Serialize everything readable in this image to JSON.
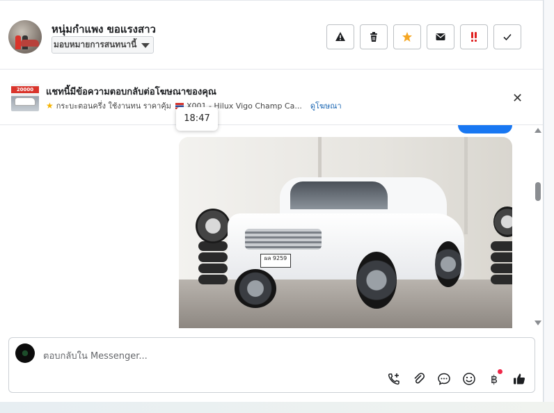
{
  "header": {
    "contact_name": "หนุ่มกำแพง ขอแรงสาว",
    "assign_label": "มอบหมายการสนทนานี้",
    "actions": [
      {
        "name": "report-spam-button",
        "icon": "warning-icon"
      },
      {
        "name": "delete-button",
        "icon": "trash-icon"
      },
      {
        "name": "star-button",
        "icon": "star-icon"
      },
      {
        "name": "mark-unread-button",
        "icon": "envelope-icon"
      },
      {
        "name": "follow-up-button",
        "icon": "exclamation-icon"
      },
      {
        "name": "mark-done-button",
        "icon": "check-icon"
      }
    ]
  },
  "ad": {
    "thumb_price": "20000",
    "title": "แชทนี้มีข้อความตอบกลับต่อโฆษณาของคุณ",
    "description": "กระบะตอนครึ่ง ใช้งานทน ราคาคุ้ม",
    "ad_name": "X001 - Hilux Vigo Champ Ca...",
    "view_ad_link": "ดูโฆษณา",
    "close_glyph": "✕"
  },
  "chat": {
    "tooltip_time": "18:47",
    "photo_plate": "ผล 9259",
    "photo_alt": "white pickup truck photo"
  },
  "composer": {
    "placeholder": "ตอบกลับใน Messenger...",
    "tools": [
      {
        "name": "call-icon",
        "label": "call"
      },
      {
        "name": "attach-icon",
        "label": "attach"
      },
      {
        "name": "saved-replies-icon",
        "label": "saved replies"
      },
      {
        "name": "emoji-icon",
        "label": "emoji"
      },
      {
        "name": "payment-icon",
        "label": "payment",
        "glyph": "฿"
      },
      {
        "name": "like-icon",
        "label": "like"
      }
    ]
  },
  "colors": {
    "accent": "#1877f2",
    "star": "#f5a623",
    "alert": "#e02020",
    "link": "#1a66b3"
  }
}
